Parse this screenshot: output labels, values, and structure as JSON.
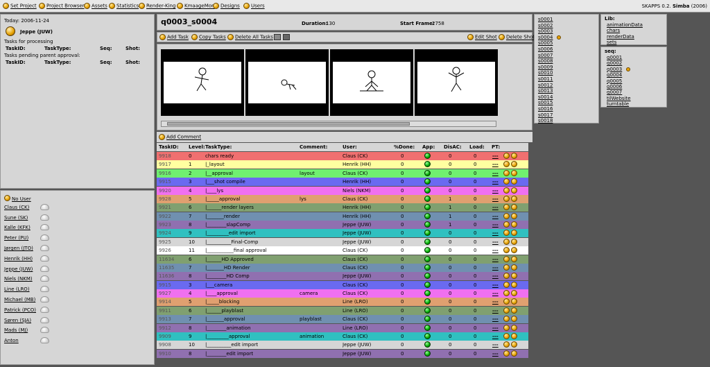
{
  "nav": {
    "items": [
      {
        "label": "Set Project"
      },
      {
        "label": "Project Browser"
      },
      {
        "label": "Assets"
      },
      {
        "label": "Statistics"
      },
      {
        "label": "Render-King"
      },
      {
        "label": "KmaageMon"
      },
      {
        "label": "Designs"
      },
      {
        "label": "Users"
      }
    ],
    "version_prefix": "SKAPPS 0.2.",
    "version_name": "Simba",
    "version_year": "(2006)"
  },
  "left_top": {
    "today": "Today: 2006-11-24",
    "user": "Jeppe (JUW)",
    "processing_title": "Tasks for processing",
    "pending_title": "Tasks pending parent approval:",
    "cols": [
      "TaskID:",
      "TaskType:",
      "Seq:",
      "Shot:"
    ]
  },
  "users": [
    "No User",
    "Claus (CK)",
    "Sune (SK)",
    "Kalle (KFK)",
    "Peter (PU)",
    "Jørgen (JTO)",
    "Henrik (HH)",
    "Jeppe (JUW)",
    "Niels (NKM)",
    "Line (LRO)",
    "Michael (MB)",
    "Patrick (PCO)",
    "Søren (SJA)",
    "Mads (MJ)",
    "Anton"
  ],
  "shot": {
    "title": "q0003_s0004",
    "duration_label": "Duration:",
    "duration": "130",
    "start_label": "Start Frame:",
    "start": "2758"
  },
  "toolbar": {
    "add_task": "Add Task",
    "copy_tasks": "Copy Tasks",
    "delete_all": "Delete All Tasks",
    "edit_shot": "Edit Shot",
    "delete_shot": "Delete Shot"
  },
  "add_comment": "Add Comment",
  "table": {
    "headers": [
      "TaskID:",
      "Level:",
      "TaskType:",
      "Comment:",
      "User:",
      "%Done:",
      "App:",
      "DisAC:",
      "Load:",
      "PT:"
    ],
    "rows": [
      {
        "id": "9918",
        "level": "0",
        "type": "chars ready",
        "comment": "",
        "user": "Claus (CK)",
        "done": "0",
        "disac": "0",
        "load": "0",
        "color": "#f07070"
      },
      {
        "id": "9917",
        "level": "1",
        "type": "|_layout",
        "comment": "",
        "user": "Henrik (HH)",
        "done": "0",
        "disac": "0",
        "load": "0",
        "color": "#ffffa0"
      },
      {
        "id": "9916",
        "level": "2",
        "type": "|__approval",
        "comment": "layout",
        "user": "Claus (CK)",
        "done": "0",
        "disac": "0",
        "load": "0",
        "color": "#70f070"
      },
      {
        "id": "9915",
        "level": "3",
        "type": "|___shot compile",
        "comment": "",
        "user": "Henrik (HH)",
        "done": "0",
        "disac": "0",
        "load": "0",
        "color": "#6a6af0"
      },
      {
        "id": "9920",
        "level": "4",
        "type": "|____lys",
        "comment": "",
        "user": "Niels (NKM)",
        "done": "0",
        "disac": "0",
        "load": "0",
        "color": "#f070f0"
      },
      {
        "id": "9928",
        "level": "5",
        "type": "|_____approval",
        "comment": "lys",
        "user": "Claus (CK)",
        "done": "0",
        "disac": "1",
        "load": "0",
        "color": "#e0a070"
      },
      {
        "id": "9921",
        "level": "6",
        "type": "|______render layers",
        "comment": "",
        "user": "Henrik (HH)",
        "done": "0",
        "disac": "1",
        "load": "0",
        "color": "#80a070"
      },
      {
        "id": "9922",
        "level": "7",
        "type": "|_______render",
        "comment": "",
        "user": "Henrik (HH)",
        "done": "0",
        "disac": "1",
        "load": "0",
        "color": "#7090b0"
      },
      {
        "id": "9923",
        "level": "8",
        "type": "|________slapComp",
        "comment": "",
        "user": "Jeppe (JUW)",
        "done": "0",
        "disac": "1",
        "load": "0",
        "color": "#9070b0"
      },
      {
        "id": "9924",
        "level": "9",
        "type": "|_________edit import",
        "comment": "",
        "user": "Jeppe (JUW)",
        "done": "0",
        "disac": "0",
        "load": "0",
        "color": "#30c0c0"
      },
      {
        "id": "9925",
        "level": "10",
        "type": "|__________Final-Comp",
        "comment": "",
        "user": "Jeppe (JUW)",
        "done": "0",
        "disac": "0",
        "load": "0",
        "color": "#d6d6d6"
      },
      {
        "id": "9926",
        "level": "11",
        "type": "|___________final approval",
        "comment": "",
        "user": "Claus (CK)",
        "done": "0",
        "disac": "0",
        "load": "0",
        "color": "#ffffff"
      },
      {
        "id": "11634",
        "level": "6",
        "type": "|______HD Approved",
        "comment": "",
        "user": "Claus (CK)",
        "done": "0",
        "disac": "0",
        "load": "0",
        "color": "#80a070"
      },
      {
        "id": "11635",
        "level": "7",
        "type": "|_______HD Render",
        "comment": "",
        "user": "Claus (CK)",
        "done": "0",
        "disac": "0",
        "load": "0",
        "color": "#7090b0"
      },
      {
        "id": "11636",
        "level": "8",
        "type": "|________HD Comp",
        "comment": "",
        "user": "Jeppe (JUW)",
        "done": "0",
        "disac": "0",
        "load": "0",
        "color": "#9070b0"
      },
      {
        "id": "9915",
        "level": "3",
        "type": "|___camera",
        "comment": "",
        "user": "Claus (CK)",
        "done": "0",
        "disac": "0",
        "load": "0",
        "color": "#6a6af0"
      },
      {
        "id": "9927",
        "level": "4",
        "type": "|____approval",
        "comment": "camera",
        "user": "Claus (CK)",
        "done": "0",
        "disac": "0",
        "load": "0",
        "color": "#f070f0"
      },
      {
        "id": "9914",
        "level": "5",
        "type": "|_____blocking",
        "comment": "",
        "user": "Line (LRO)",
        "done": "0",
        "disac": "0",
        "load": "0",
        "color": "#e0a070"
      },
      {
        "id": "9911",
        "level": "6",
        "type": "|______playblast",
        "comment": "",
        "user": "Line (LRO)",
        "done": "0",
        "disac": "0",
        "load": "0",
        "color": "#80a070"
      },
      {
        "id": "9913",
        "level": "7",
        "type": "|_______approval",
        "comment": "playblast",
        "user": "Claus (CK)",
        "done": "0",
        "disac": "0",
        "load": "0",
        "color": "#7090b0"
      },
      {
        "id": "9912",
        "level": "8",
        "type": "|________animation",
        "comment": "",
        "user": "Line (LRO)",
        "done": "0",
        "disac": "0",
        "load": "0",
        "color": "#9070b0"
      },
      {
        "id": "9909",
        "level": "9",
        "type": "|_________approval",
        "comment": "animation",
        "user": "Claus (CK)",
        "done": "0",
        "disac": "0",
        "load": "0",
        "color": "#30c0c0"
      },
      {
        "id": "9908",
        "level": "10",
        "type": "|__________edit import",
        "comment": "",
        "user": "Jeppe (JUW)",
        "done": "0",
        "disac": "0",
        "load": "0",
        "color": "#d6d6d6"
      },
      {
        "id": "9910",
        "level": "8",
        "type": "|________edit import",
        "comment": "",
        "user": "Jeppe (JUW)",
        "done": "0",
        "disac": "0",
        "load": "0",
        "color": "#9070b0"
      }
    ],
    "pt_label": "---"
  },
  "shots": [
    "s0001",
    "s0002",
    "s0003",
    "s0004",
    "s0005",
    "s0006",
    "s0007",
    "s0008",
    "s0009",
    "s0010",
    "s0011",
    "s0012",
    "s0013",
    "s0014",
    "s0015",
    "s0016",
    "s0017",
    "s0018"
  ],
  "lib": {
    "title": "Lib:",
    "items": [
      "animationData",
      "chars",
      "renderData",
      "sets"
    ]
  },
  "seq": {
    "title": "seq:",
    "items": [
      "q0001",
      "q0002",
      "q0003",
      "q0004",
      "q0005",
      "q0006",
      "q0007",
      "tilWebsite",
      "turntable"
    ]
  }
}
